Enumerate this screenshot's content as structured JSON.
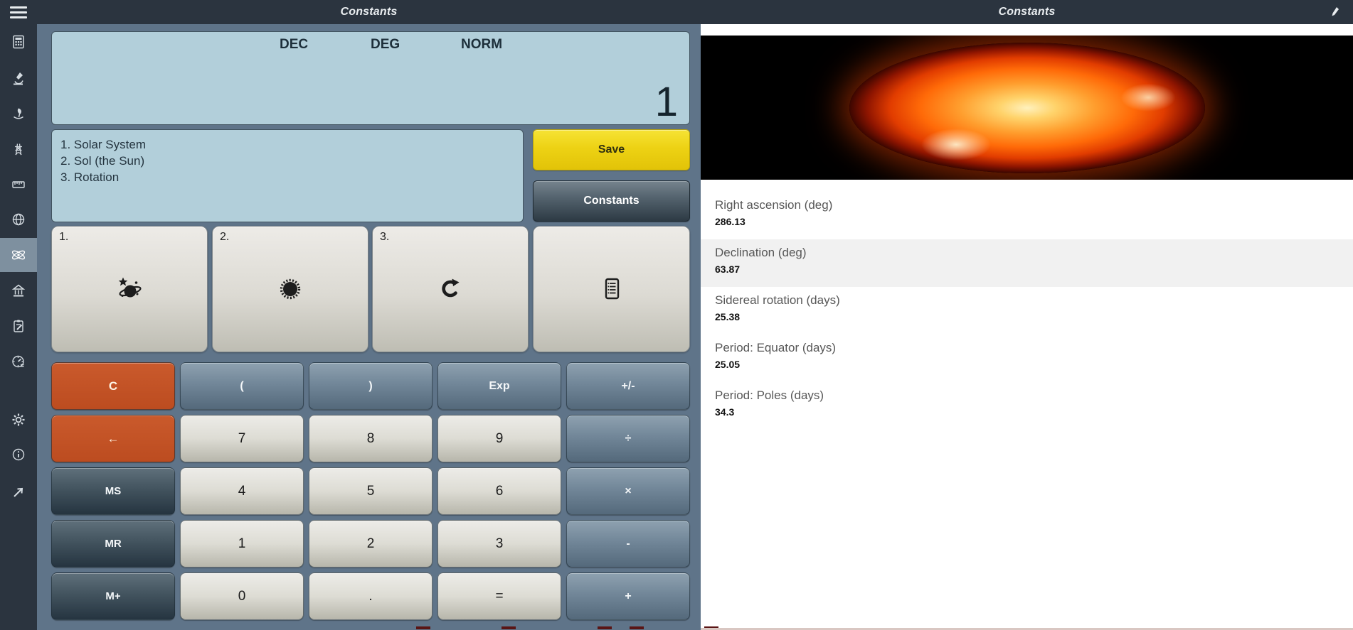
{
  "titlebar": {
    "left_title": "Constants",
    "right_title": "Constants",
    "menu_icon": "hamburger-icon",
    "edit_icon": "pen-icon"
  },
  "sidebar": {
    "selected_index": 6,
    "items": [
      {
        "icon": "calculator-icon"
      },
      {
        "icon": "microscope-icon"
      },
      {
        "icon": "hand-plant-icon"
      },
      {
        "icon": "pylon-icon"
      },
      {
        "icon": "ruler-icon"
      },
      {
        "icon": "globe-icon"
      },
      {
        "icon": "atom-icon",
        "selected": true
      },
      {
        "icon": "bank-icon"
      },
      {
        "icon": "clipboard-icon"
      },
      {
        "icon": "globe-gauge-icon"
      }
    ],
    "footer_items": [
      {
        "icon": "gear-icon"
      },
      {
        "icon": "info-icon"
      },
      {
        "icon": "share-arrow-icon"
      }
    ]
  },
  "calculator": {
    "display": {
      "value": "1",
      "indicators": [
        "DEC",
        "DEG",
        "NORM"
      ]
    },
    "path_lines": [
      "1. Solar System",
      "2. Sol (the Sun)",
      "3. Rotation"
    ],
    "save_button": "Save",
    "constants_button": "Constants",
    "selection_buttons": [
      {
        "number": "1.",
        "icon": "planet-icon"
      },
      {
        "number": "2.",
        "icon": "sun-icon"
      },
      {
        "number": "3.",
        "icon": "rotation-icon"
      },
      {
        "number": "",
        "icon": "list-icon"
      }
    ],
    "keys": [
      {
        "label": "C",
        "type": "clear"
      },
      {
        "label": "(",
        "type": "operator"
      },
      {
        "label": ")",
        "type": "operator"
      },
      {
        "label": "Exp",
        "type": "operator"
      },
      {
        "label": "+/-",
        "type": "operator"
      },
      {
        "label": "←",
        "type": "clear"
      },
      {
        "label": "7",
        "type": "number"
      },
      {
        "label": "8",
        "type": "number"
      },
      {
        "label": "9",
        "type": "number"
      },
      {
        "label": "÷",
        "type": "operator"
      },
      {
        "label": "MS",
        "type": "memory"
      },
      {
        "label": "4",
        "type": "number"
      },
      {
        "label": "5",
        "type": "number"
      },
      {
        "label": "6",
        "type": "number"
      },
      {
        "label": "×",
        "type": "operator"
      },
      {
        "label": "MR",
        "type": "memory"
      },
      {
        "label": "1",
        "type": "number"
      },
      {
        "label": "2",
        "type": "number"
      },
      {
        "label": "3",
        "type": "number"
      },
      {
        "label": "-",
        "type": "operator"
      },
      {
        "label": "M+",
        "type": "memory"
      },
      {
        "label": "0",
        "type": "number"
      },
      {
        "label": ".",
        "type": "number"
      },
      {
        "label": "=",
        "type": "number"
      },
      {
        "label": "+",
        "type": "operator"
      }
    ]
  },
  "constants_panel": {
    "image": "sun-photo",
    "entries": [
      {
        "label": "Right ascension (deg)",
        "value": "286.13",
        "highlighted": false
      },
      {
        "label": "Declination (deg)",
        "value": "63.87",
        "highlighted": true
      },
      {
        "label": "Sidereal rotation (days)",
        "value": "25.38",
        "highlighted": false
      },
      {
        "label": "Period: Equator (days)",
        "value": "25.05",
        "highlighted": false
      },
      {
        "label": "Period: Poles (days)",
        "value": "34.3",
        "highlighted": false
      }
    ]
  },
  "colors": {
    "titlebar": "#2b343f",
    "panel_background": "#5f7489",
    "display_background": "#b2cfda",
    "save_yellow": "#e9cb10",
    "clear_orange": "#c25326",
    "sidebar_selected": "#7e909f",
    "highlight_row": "#f1f1f1"
  }
}
